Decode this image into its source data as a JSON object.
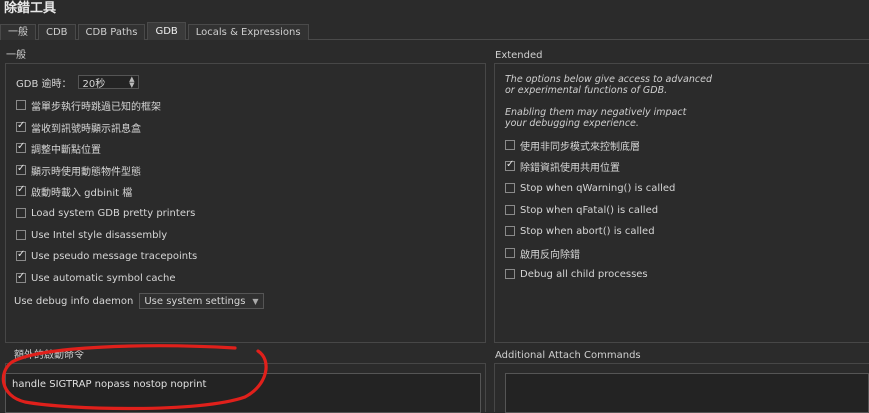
{
  "window": {
    "title": "除錯工具"
  },
  "tabs": [
    {
      "label": "一般",
      "active": false
    },
    {
      "label": "CDB",
      "active": false
    },
    {
      "label": "CDB Paths",
      "active": false
    },
    {
      "label": "GDB",
      "active": true
    },
    {
      "label": "Locals & Expressions",
      "active": false
    }
  ],
  "general": {
    "label": "一般",
    "timeout_label": "GDB 逾時：",
    "timeout_value": "20秒",
    "options": [
      {
        "label": "當單步執行時跳過已知的框架",
        "checked": false
      },
      {
        "label": "當收到訊號時顯示訊息盒",
        "checked": true
      },
      {
        "label": "調整中斷點位置",
        "checked": true
      },
      {
        "label": "顯示時使用動態物件型態",
        "checked": true
      },
      {
        "label": "啟動時載入 gdbinit 檔",
        "checked": true
      },
      {
        "label": "Load system GDB pretty printers",
        "checked": false
      },
      {
        "label": "Use Intel style disassembly",
        "checked": false
      },
      {
        "label": "Use pseudo message tracepoints",
        "checked": true
      },
      {
        "label": "Use automatic symbol cache",
        "checked": true
      }
    ],
    "debuginfod_label": "Use debug info daemon",
    "debuginfod_value": "Use system settings"
  },
  "extended": {
    "label": "Extended",
    "note1_line1": "The options below give access to advanced",
    "note1_line2": "or experimental functions of GDB.",
    "note2_line1": "Enabling them may negatively impact",
    "note2_line2": "your debugging experience.",
    "options": [
      {
        "label": "使用非同步模式來控制底層",
        "checked": false
      },
      {
        "label": "除錯資訊使用共用位置",
        "checked": true
      },
      {
        "label": "Stop when qWarning() is called",
        "checked": false
      },
      {
        "label": "Stop when qFatal() is called",
        "checked": false
      },
      {
        "label": "Stop when abort() is called",
        "checked": false
      },
      {
        "label": "啟用反向除錯",
        "checked": false
      },
      {
        "label": "Debug all child processes",
        "checked": false
      }
    ]
  },
  "startup": {
    "label": "額外的啟動命令",
    "commands": "handle SIGTRAP nopass nostop noprint"
  },
  "attach": {
    "label": "Additional Attach Commands"
  },
  "colors": {
    "annotation": "#e0201b",
    "panel_border": "#474747",
    "background": "#2b2b2b"
  }
}
